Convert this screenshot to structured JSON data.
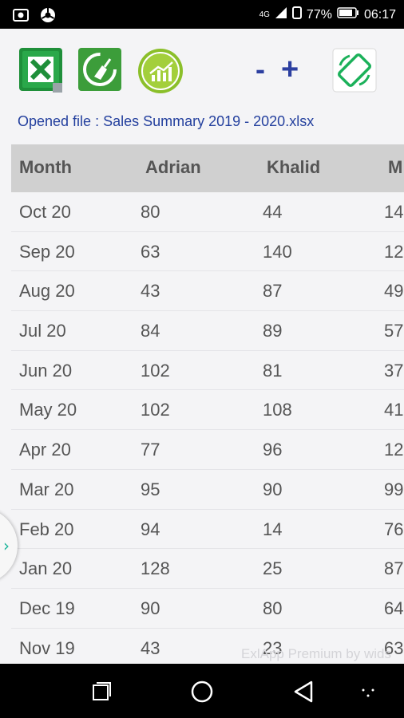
{
  "status_bar": {
    "network": "4G",
    "battery": "77%",
    "time": "06:17"
  },
  "toolbar": {
    "open_file_icon": "excel-icon",
    "clear_icon": "broom-icon",
    "chart_icon": "chart-icon",
    "zoom_out_label": "-",
    "zoom_in_label": "+",
    "rotate_icon": "rotate-screen-icon"
  },
  "opened_file": "Opened file : Sales Summary 2019 - 2020.xlsx",
  "table": {
    "headers": [
      "Month",
      "Adrian",
      "Khalid",
      "M"
    ],
    "rows": [
      [
        "Oct 20",
        "80",
        "44",
        "14"
      ],
      [
        "Sep 20",
        "63",
        "140",
        "12"
      ],
      [
        "Aug 20",
        "43",
        "87",
        "49"
      ],
      [
        "Jul 20",
        "84",
        "89",
        "57"
      ],
      [
        "Jun 20",
        "102",
        "81",
        "37"
      ],
      [
        "May 20",
        "102",
        "108",
        "41"
      ],
      [
        "Apr 20",
        "77",
        "96",
        "12"
      ],
      [
        "Mar 20",
        "95",
        "90",
        "99"
      ],
      [
        "Feb 20",
        "94",
        "14",
        "76"
      ],
      [
        "Jan 20",
        "128",
        "25",
        "87"
      ],
      [
        "Dec 19",
        "90",
        "80",
        "64"
      ],
      [
        "Nov 19",
        "43",
        "23",
        "63"
      ]
    ]
  },
  "watermark": "ExlApp Premium by wids",
  "side_tab_icon": "chevron-right-icon",
  "colors": {
    "excel_green": "#1f8f3a",
    "chart_green": "#8bbf2a",
    "zoom_blue": "#2c3fa0",
    "header_gray": "#d0d0d0",
    "accent_teal": "#1bb59a"
  }
}
